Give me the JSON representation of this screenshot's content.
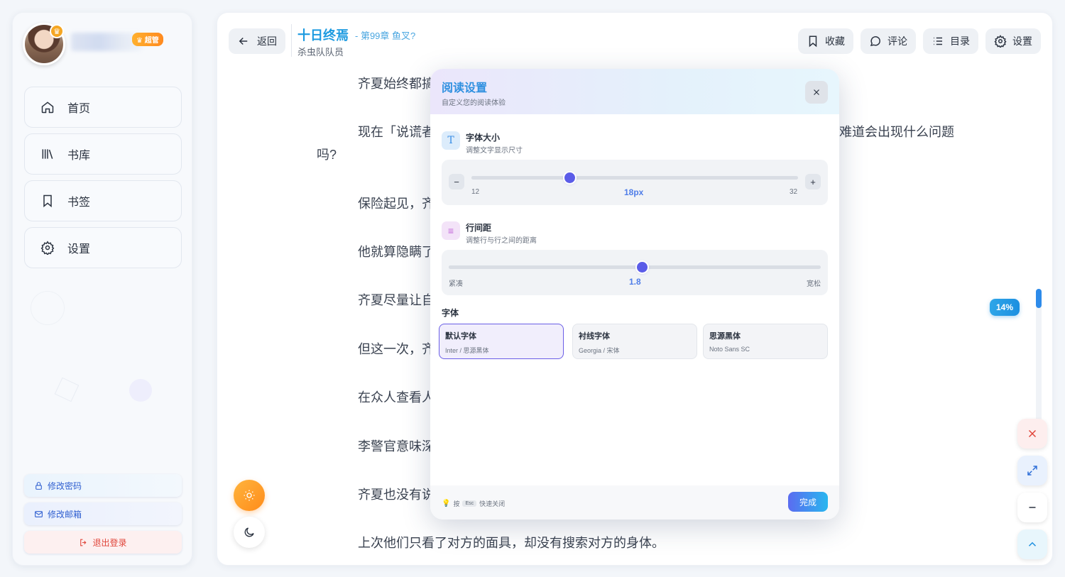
{
  "sidebar": {
    "badge": "超管",
    "nav": [
      {
        "label": "首页",
        "icon": "home-icon"
      },
      {
        "label": "书库",
        "icon": "library-icon"
      },
      {
        "label": "书签",
        "icon": "bookmark-icon"
      },
      {
        "label": "设置",
        "icon": "gear-icon"
      }
    ],
    "change_password": "修改密码",
    "change_email": "修改邮箱",
    "logout": "退出登录"
  },
  "header": {
    "back": "返回",
    "book_title": "十日终焉",
    "chapter": "- 第99章 鱼叉?",
    "author": "杀虫队队员",
    "actions": {
      "favorite": "收藏",
      "comment": "评论",
      "toc": "目录",
      "settings": "设置"
    }
  },
  "content": {
    "paragraphs": [
      "齐夏始终都搞",
      "现在「说谎者",
      "难道会出现什么问题",
      "吗?",
      "保险起见，齐",
      "他就算隐瞒了",
      "齐夏尽量让自",
      "但这一次，齐",
      "在众人查看人",
      "李警官意味深",
      "齐夏也没有说",
      "上次他们只看了对方的面具，却没有搜索对方的身体。"
    ]
  },
  "progress": {
    "label": "14%",
    "value": 0.14
  },
  "modal": {
    "title": "阅读设置",
    "subtitle": "自定义您的阅读体验",
    "font_size": {
      "title": "字体大小",
      "desc": "调整文字显示尺寸",
      "min": "12",
      "max": "32",
      "value_label": "18px",
      "value": 18,
      "decrease": "−",
      "increase": "+"
    },
    "line_height": {
      "title": "行间距",
      "desc": "调整行与行之间的距离",
      "min_label": "紧凑",
      "max_label": "宽松",
      "value_label": "1.8",
      "value": 0.52
    },
    "font_family": {
      "label": "字体",
      "options": [
        {
          "name": "默认字体",
          "desc": "Inter / 思源黑体",
          "selected": true
        },
        {
          "name": "衬线字体",
          "desc": "Georgia / 宋体",
          "selected": false
        },
        {
          "name": "思源黑体",
          "desc": "Noto Sans SC",
          "selected": false
        }
      ]
    },
    "footer": {
      "hint_pre": "按",
      "key": "Esc",
      "hint_post": "快速关闭",
      "done": "完成"
    }
  },
  "colors": {
    "accent": "#2f90e0",
    "thumb": "#5b5ce8",
    "sun": "#ff9d2a"
  }
}
